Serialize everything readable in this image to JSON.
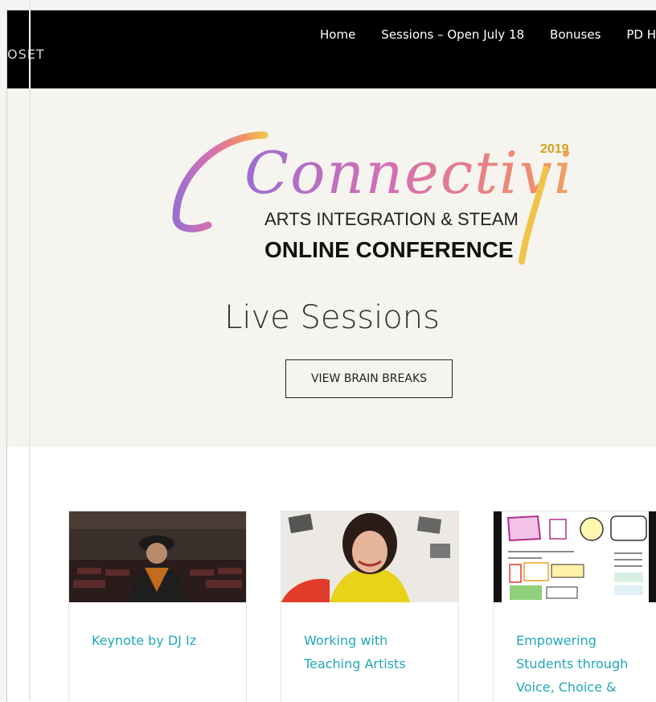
{
  "brand": "OSET",
  "nav": [
    "Home",
    "Sessions – Open July 18",
    "Bonuses",
    "PD Ho"
  ],
  "logo": {
    "script_text": "Connectivity",
    "year": "2019",
    "line1": "ARTS INTEGRATION & STEAM",
    "line2": "ONLINE CONFERENCE"
  },
  "hero": {
    "heading": "Live Sessions",
    "button": "VIEW BRAIN BREAKS"
  },
  "cards": [
    {
      "title": "Keynote by DJ Iz"
    },
    {
      "title": "Working with Teaching Artists"
    },
    {
      "title": "Empowering Students through Voice, Choice &"
    }
  ],
  "colors": {
    "accent": "#22a7b8",
    "header_bg": "#000000",
    "hero_bg": "#f5f4ee"
  }
}
